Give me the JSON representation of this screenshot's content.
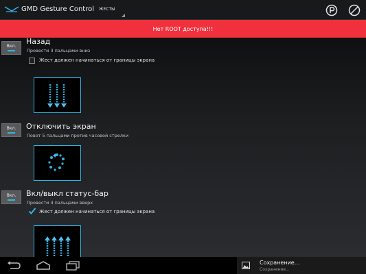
{
  "action_bar": {
    "app_title": "GMD Gesture Control",
    "tab_selector": "ЖЕСТЫ",
    "app_icon": "gesture-logo-icon",
    "actions": [
      "premium-icon",
      "disable-icon"
    ]
  },
  "banner": {
    "text": "Нет ROOT доступа!!!",
    "color": "#f0303c"
  },
  "gestures": [
    {
      "toggle_label": "Вкл.",
      "title": "Назад",
      "description": "Провести 3 пальцами вниз",
      "edge_label": "Жест должен начинаться от границы экрана",
      "edge_checked": false,
      "preview_icon": "three-finger-swipe-down-icon"
    },
    {
      "toggle_label": "Вкл.",
      "title": "Отключить экран",
      "description": "Повот 5 пальцами против часовой стрелки",
      "preview_icon": "five-finger-rotate-icon"
    },
    {
      "toggle_label": "Вкл.",
      "title": "Вкл/выкл статус-бар",
      "description": "Провести 4 пальцами вверх",
      "edge_label": "Жест должен начинаться от границы экрана",
      "edge_checked": true,
      "preview_icon": "four-finger-swipe-up-icon"
    }
  ],
  "nav_bar": {
    "buttons": [
      "back-icon",
      "home-icon",
      "recents-icon"
    ]
  },
  "notification": {
    "title": "Сохранение...",
    "subtitle": "Сохранение...",
    "icon": "picture-icon"
  },
  "colors": {
    "accent": "#33b5e5",
    "banner": "#f0303c",
    "action_bar": "#17191b"
  }
}
